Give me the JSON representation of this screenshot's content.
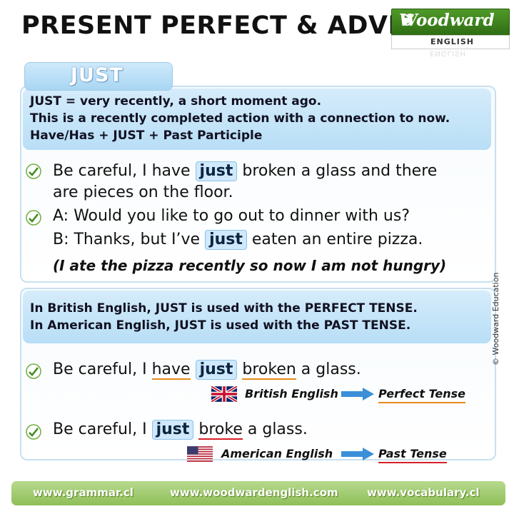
{
  "header": {
    "title": "PRESENT PERFECT & ADVERBS",
    "logo_brand": "Woodward",
    "logo_sub": "ENGLISH"
  },
  "tab_label": "JUST",
  "definition": {
    "line1": "JUST = very recently, a short moment ago.",
    "line2": "This is a recently completed action with a connection to now.",
    "line3": "Have/Has + JUST + Past Participle"
  },
  "example1": {
    "part1": "Be careful, I have ",
    "highlight": "just",
    "part2": " broken a glass and there",
    "line2": "are pieces on the floor."
  },
  "example2": {
    "lineA": "A: Would you like to go out to dinner with us?",
    "lineB_part1": "B: Thanks, but I’ve ",
    "highlight": "just",
    "lineB_part2": " eaten an entire pizza.",
    "note": "(I ate the pizza recently so now I am not hungry)"
  },
  "usage": {
    "line1": "In British English, JUST is used with the PERFECT TENSE.",
    "line2": "In American English, JUST is used with the PAST TENSE."
  },
  "british": {
    "prefix": "Be careful, I ",
    "aux": "have",
    "highlight": "just",
    "verb": "broken",
    "suffix": " a glass.",
    "label": "British English",
    "tense": "Perfect Tense"
  },
  "american": {
    "prefix": "Be careful, I ",
    "highlight": "just",
    "verb": "broke",
    "suffix": " a glass.",
    "label": "American English",
    "tense": "Past Tense"
  },
  "copyright": "© Woodward Education",
  "footer": {
    "left": "www.grammar.cl",
    "center": "www.woodwardenglish.com",
    "right": "www.vocabulary.cl"
  },
  "icons": [
    "check-leaf-icon",
    "uk-flag-icon",
    "us-flag-icon",
    "arrow-right-icon",
    "fern-icon"
  ],
  "colors": {
    "accent_blue": "#b8def6",
    "highlight_blue": "#cfe8fb",
    "green_footer": "#8fbf58",
    "underline_orange": "#e8891c",
    "underline_red": "#d8202a"
  }
}
